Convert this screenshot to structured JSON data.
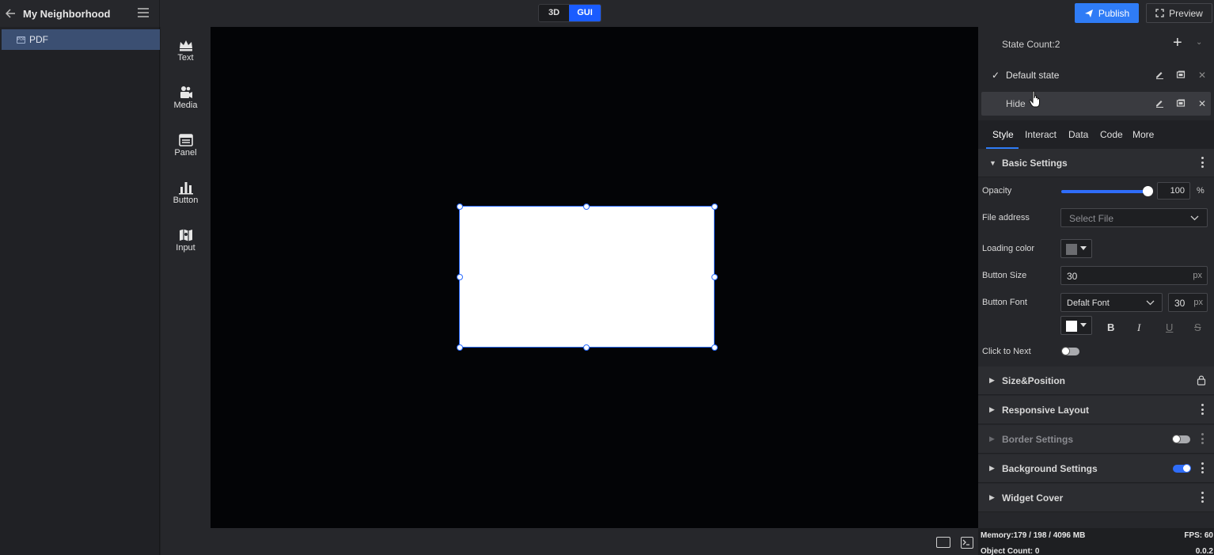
{
  "project": {
    "title": "My Neighborhood"
  },
  "mode": {
    "options": [
      "3D",
      "GUI"
    ],
    "active": "GUI"
  },
  "actions": {
    "publish": "Publish",
    "preview": "Preview"
  },
  "layers": [
    {
      "name": "PDF",
      "icon": "pdf-icon",
      "selected": true
    }
  ],
  "widgets": [
    {
      "label": "Text",
      "icon": "crown-icon"
    },
    {
      "label": "Media",
      "icon": "video-camera-icon"
    },
    {
      "label": "Panel",
      "icon": "panel-icon"
    },
    {
      "label": "Button",
      "icon": "bar-chart-icon"
    },
    {
      "label": "Input",
      "icon": "map-icon"
    }
  ],
  "states": {
    "count_label": "State Count:2",
    "items": [
      {
        "name": "Default state",
        "checked": true
      },
      {
        "name": "Hide",
        "checked": false
      }
    ]
  },
  "tabs": [
    "Style",
    "Interact",
    "Data",
    "Code",
    "More"
  ],
  "active_tab": "Style",
  "basic": {
    "title": "Basic Settings",
    "opacity_label": "Opacity",
    "opacity_value": "100",
    "opacity_unit": "%",
    "opacity_level": 1.0,
    "file_label": "File address",
    "file_placeholder": "Select File",
    "loading_color_label": "Loading color",
    "loading_color": "#6b6c70",
    "button_size_label": "Button Size",
    "button_size_value": "30",
    "button_size_unit": "px",
    "button_font_label": "Button Font",
    "button_font_value": "Defalt Font",
    "button_font_size": "30",
    "button_font_unit": "px",
    "font_color": "#ffffff",
    "format": {
      "bold": "B",
      "italic": "I",
      "underline": "U",
      "strike": "S"
    },
    "click_next_label": "Click to Next",
    "click_next_on": false
  },
  "sections": [
    {
      "title": "Size&Position",
      "trail": "lock-icon"
    },
    {
      "title": "Responsive Layout",
      "trail": "kebab-icon"
    },
    {
      "title": "Border Settings",
      "trail": "toggle-off",
      "dim": true
    },
    {
      "title": "Background Settings",
      "trail": "toggle-on"
    },
    {
      "title": "Widget Cover",
      "trail": "kebab-icon"
    }
  ],
  "status": {
    "memory": "Memory:179 / 198 / 4096 MB",
    "fps": "FPS: 60",
    "objects": "Object Count: 0",
    "version": "0.0.2"
  },
  "colors": {
    "accent": "#2f7cf6",
    "selection": "#2b6cff",
    "canvas": "#030406"
  }
}
